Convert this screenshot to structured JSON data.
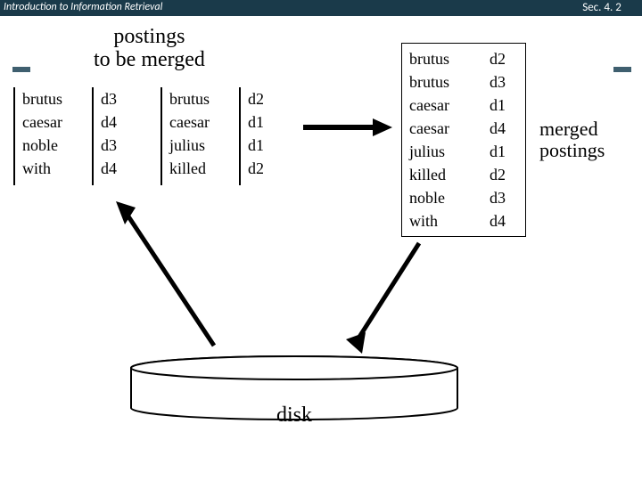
{
  "header": {
    "course": "Introduction to Information Retrieval",
    "section": "Sec. 4. 2"
  },
  "labels": {
    "postings_title_l1": "postings",
    "postings_title_l2": "to be merged",
    "merged_l1": "merged",
    "merged_l2": "postings",
    "disk": "disk"
  },
  "block1": {
    "terms": [
      "brutus",
      "caesar",
      "noble",
      "with"
    ],
    "docs": [
      "d3",
      "d4",
      "d3",
      "d4"
    ]
  },
  "block2": {
    "terms": [
      "brutus",
      "caesar",
      "julius",
      "killed"
    ],
    "docs": [
      "d2",
      "d1",
      "d1",
      "d2"
    ]
  },
  "merged": {
    "terms": [
      "brutus",
      "brutus",
      "caesar",
      "caesar",
      "julius",
      "killed",
      "noble",
      "with"
    ],
    "docs": [
      "d2",
      "d3",
      "d1",
      "d4",
      "d1",
      "d2",
      "d3",
      "d4"
    ]
  }
}
